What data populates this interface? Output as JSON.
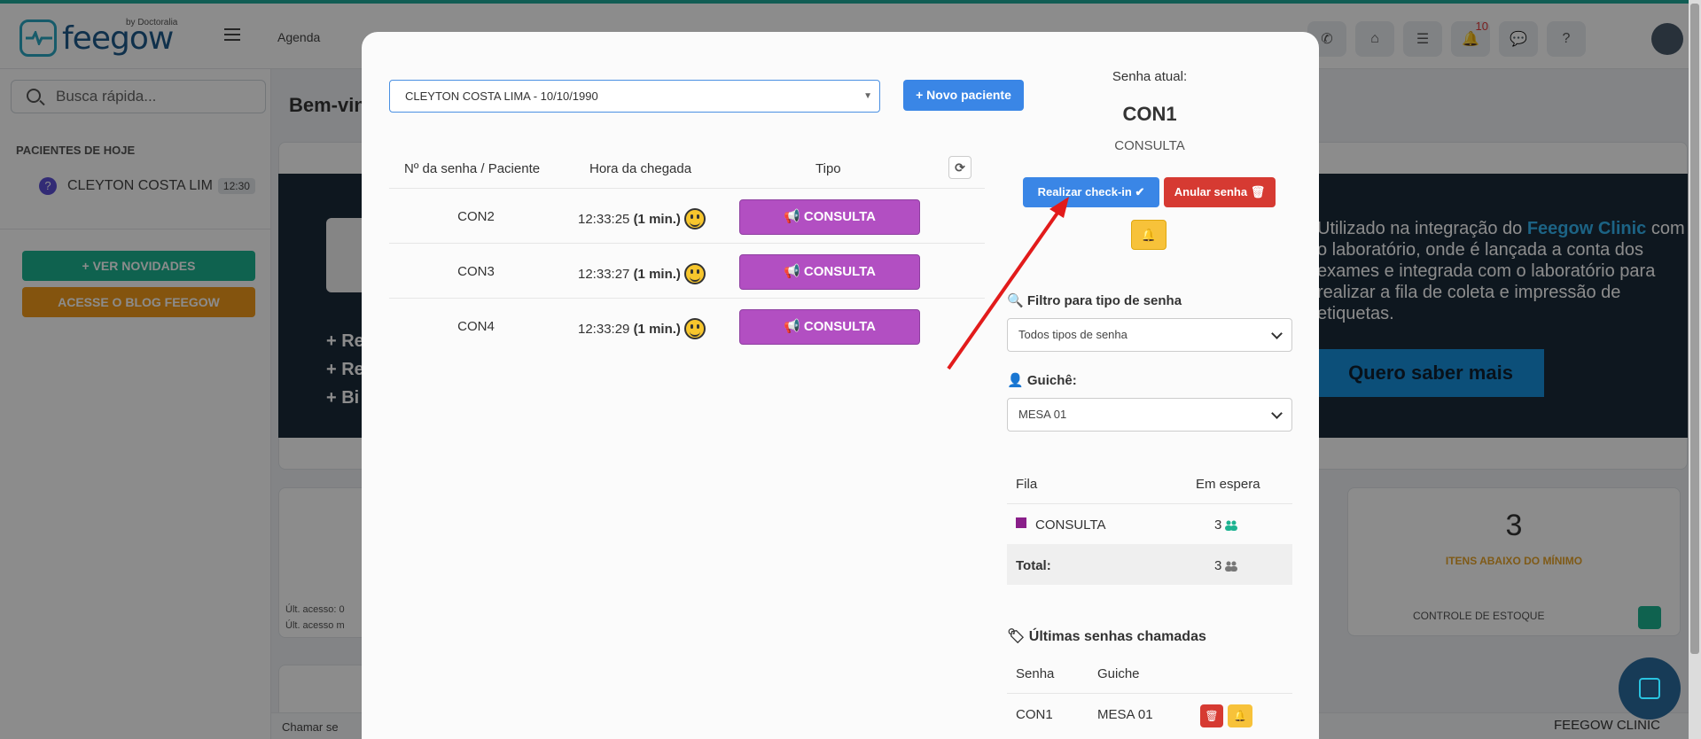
{
  "nav": {
    "logo_text": "feegow",
    "logo_by": "by Doctoralia",
    "agenda_label": "Agenda",
    "notifications_count": "10"
  },
  "sidebar": {
    "search_placeholder": "Busca rápida...",
    "heading": "PACIENTES DE HOJE",
    "patient_name": "CLEYTON COSTA LIM",
    "patient_time": "12:30",
    "novidades_label": "+ VER NOVIDADES",
    "blog_label": "ACESSE O BLOG FEEGOW"
  },
  "main": {
    "title": "Bem-vin",
    "banner_items": [
      "+ Re",
      "+ Re",
      "+ Bi"
    ],
    "banner_text_1": "Utilizado na integração do ",
    "banner_text_hl": "Feegow Clinic",
    "banner_text_2": " com o laboratório, onde é lançada a conta dos exames e integrada com o laboratório para realizar a fila de coleta e impressão de etiquetas.",
    "banner_cta": "Quero saber mais",
    "last_access_1": "Últ. acesso: 0",
    "last_access_2": "Últ. acesso m",
    "stock_number": "3",
    "stock_label": "ITENS ABAIXO DO MÍNIMO",
    "stock_link": "CONTROLE DE ESTOQUE",
    "footer_left": "Chamar se",
    "footer_right": "FEEGOW CLINIC"
  },
  "modal": {
    "patient_value": "CLEYTON COSTA LIMA - 10/10/1990",
    "novo_paciente": "+ Novo paciente",
    "table_headers": [
      "Nº da senha / Paciente",
      "Hora da chegada",
      "Tipo"
    ],
    "queue": [
      {
        "code": "CON2",
        "time": "12:33:25",
        "wait": "(1 min.)",
        "tipo": "CONSULTA"
      },
      {
        "code": "CON3",
        "time": "12:33:27",
        "wait": "(1 min.)",
        "tipo": "CONSULTA"
      },
      {
        "code": "CON4",
        "time": "12:33:29",
        "wait": "(1 min.)",
        "tipo": "CONSULTA"
      }
    ],
    "senha_atual_label": "Senha atual:",
    "senha_atual_code": "CON1",
    "senha_atual_type": "CONSULTA",
    "checkin_label": "Realizar check-in ✔",
    "anular_label": "Anular senha 🗑",
    "filtro_label": "Filtro para tipo de senha",
    "filtro_value": "Todos tipos de senha",
    "guiche_label": "Guichê:",
    "guiche_value": "MESA 01",
    "fila_headers": [
      "Fila",
      "Em espera"
    ],
    "fila_rows": [
      {
        "name": "CONSULTA",
        "count": "3"
      }
    ],
    "total_label": "Total:",
    "total_count": "3",
    "ultimas_title": "Últimas senhas chamadas",
    "ultimas_headers": [
      "Senha",
      "Guiche"
    ],
    "ultimas_rows": [
      {
        "senha": "CON1",
        "guiche": "MESA 01"
      }
    ],
    "colors": {
      "consulta": "#b24fc2",
      "primary": "#3a86e6",
      "danger": "#d63a32",
      "warning": "#f7c23a"
    }
  }
}
